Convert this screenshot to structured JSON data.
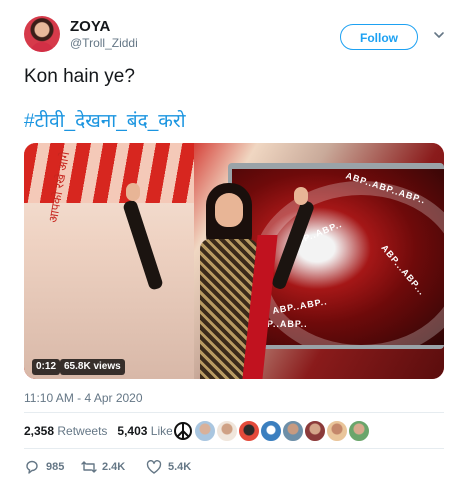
{
  "author": {
    "display_name": "ZOYA",
    "handle": "@Troll_Ziddi"
  },
  "follow_button": "Follow",
  "tweet": {
    "text": "Kon hain ye?",
    "hashtag": "#टीवी_देखना_बंद_करो"
  },
  "media": {
    "duration": "0:12",
    "views": "65.8K views",
    "wall_text": "आपको रखे आगे",
    "screen_texts": [
      "ABP..ABP..ABP..",
      "ABP..ABP..",
      "ABP...ABP...",
      "ABP..ABP..",
      "ABP..ABP.."
    ]
  },
  "timestamp": "11:10 AM - 4 Apr 2020",
  "stats": {
    "retweets_count": "2,358",
    "retweets_label": "Retweets",
    "likes_count": "5,403",
    "likes_label": "Likes"
  },
  "actions": {
    "reply_count": "985",
    "retweet_count": "2.4K",
    "like_count": "5.4K"
  },
  "colors": {
    "accent": "#1da1f2",
    "hashtag": "#1b95e0",
    "muted": "#657786",
    "text": "#14171a"
  }
}
